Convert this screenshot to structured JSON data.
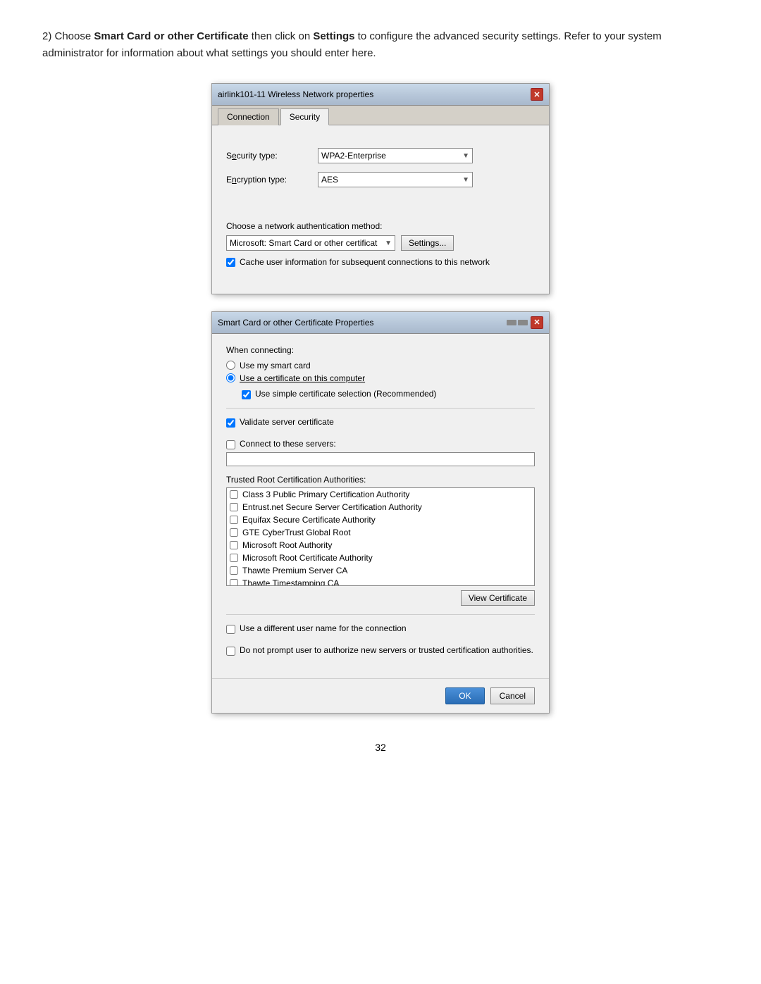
{
  "intro": {
    "text_start": "2) Choose ",
    "bold1": "Smart Card or other Certificate",
    "text_middle": " then click on ",
    "bold2": "Settings",
    "text_end": " to configure the advanced security settings. Refer to your system administrator for information about what settings you should enter here."
  },
  "dialog1": {
    "title": "airlink101-11 Wireless Network properties",
    "tabs": [
      {
        "label": "Connection",
        "active": false
      },
      {
        "label": "Security",
        "active": true
      }
    ],
    "security_type_label": "Security type:",
    "security_type_value": "WPA2-Enterprise",
    "encryption_type_label": "Encryption type:",
    "encryption_type_value": "AES",
    "auth_method_label": "Choose a network authentication method:",
    "auth_method_value": "Microsoft: Smart Card or other certificat",
    "settings_btn": "Settings...",
    "cache_checkbox_label": "Cache user information for subsequent connections to this network",
    "cache_checked": true
  },
  "dialog2": {
    "title": "Smart Card or other Certificate Properties",
    "when_connecting_label": "When connecting:",
    "radio_smart_card": "Use my smart card",
    "radio_certificate": "Use a certificate on this computer",
    "radio_certificate_selected": true,
    "use_simple_cert_label": "Use simple certificate selection (Recommended)",
    "use_simple_cert_checked": true,
    "validate_server_label": "Validate server certificate",
    "validate_server_checked": true,
    "connect_servers_label": "Connect to these servers:",
    "connect_servers_checked": false,
    "trusted_root_label": "Trusted Root Certification Authorities:",
    "cert_list": [
      {
        "label": "Class 3 Public Primary Certification Authority",
        "checked": false
      },
      {
        "label": "Entrust.net Secure Server Certification Authority",
        "checked": false
      },
      {
        "label": "Equifax Secure Certificate Authority",
        "checked": false
      },
      {
        "label": "GTE CyberTrust Global Root",
        "checked": false
      },
      {
        "label": "Microsoft Root Authority",
        "checked": false
      },
      {
        "label": "Microsoft Root Certificate Authority",
        "checked": false
      },
      {
        "label": "Thawte Premium Server CA",
        "checked": false
      },
      {
        "label": "Thawte Timestamping CA",
        "checked": false
      }
    ],
    "view_cert_btn": "View Certificate",
    "diff_user_label": "Use a different user name for the connection",
    "diff_user_checked": false,
    "no_prompt_label": "Do not prompt user to authorize new servers or trusted certification authorities.",
    "no_prompt_checked": false,
    "ok_btn": "OK",
    "cancel_btn": "Cancel"
  },
  "page_number": "32"
}
